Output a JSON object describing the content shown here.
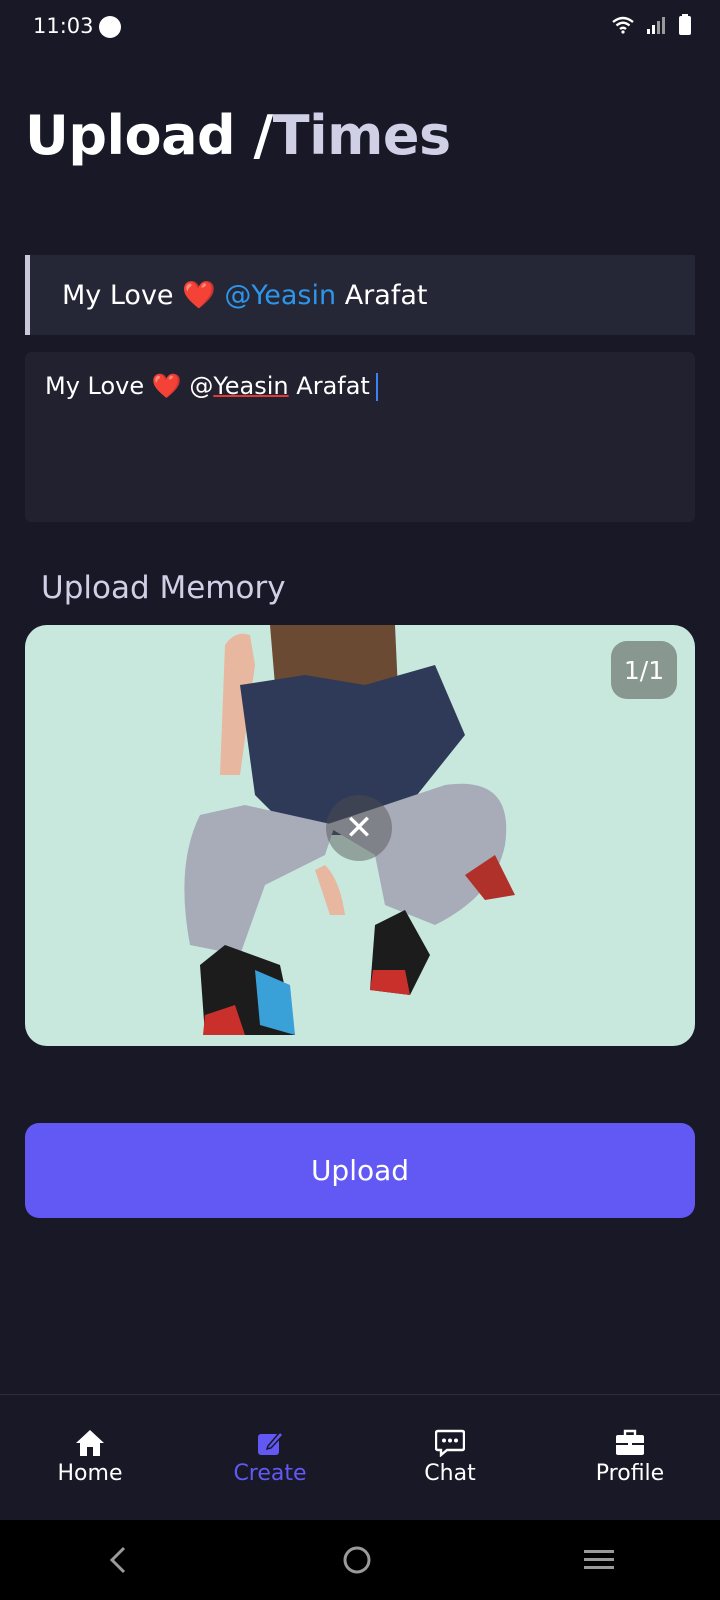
{
  "status_bar": {
    "time": "11:03"
  },
  "page": {
    "title_part1": "Upload /",
    "title_part2": "Times"
  },
  "preview": {
    "text_before": "My Love",
    "heart": "❤️",
    "mention": "@Yeasin",
    "text_after": "Arafat"
  },
  "caption": {
    "text_before": "My Love",
    "heart": "❤️",
    "at": "@",
    "underlined": "Yeasin",
    "text_after": "Arafat"
  },
  "memory": {
    "section_label": "Upload Memory",
    "counter": "1/1"
  },
  "upload_button_label": "Upload",
  "bottom_nav": [
    {
      "label": "Home",
      "icon": "home-icon",
      "active": false
    },
    {
      "label": "Create",
      "icon": "edit-icon",
      "active": true
    },
    {
      "label": "Chat",
      "icon": "chat-icon",
      "active": false
    },
    {
      "label": "Profile",
      "icon": "briefcase-icon",
      "active": false
    }
  ],
  "colors": {
    "background": "#181827",
    "accent": "#6259f4",
    "mention": "#2d95ea",
    "image_background": "#c8e8de"
  }
}
